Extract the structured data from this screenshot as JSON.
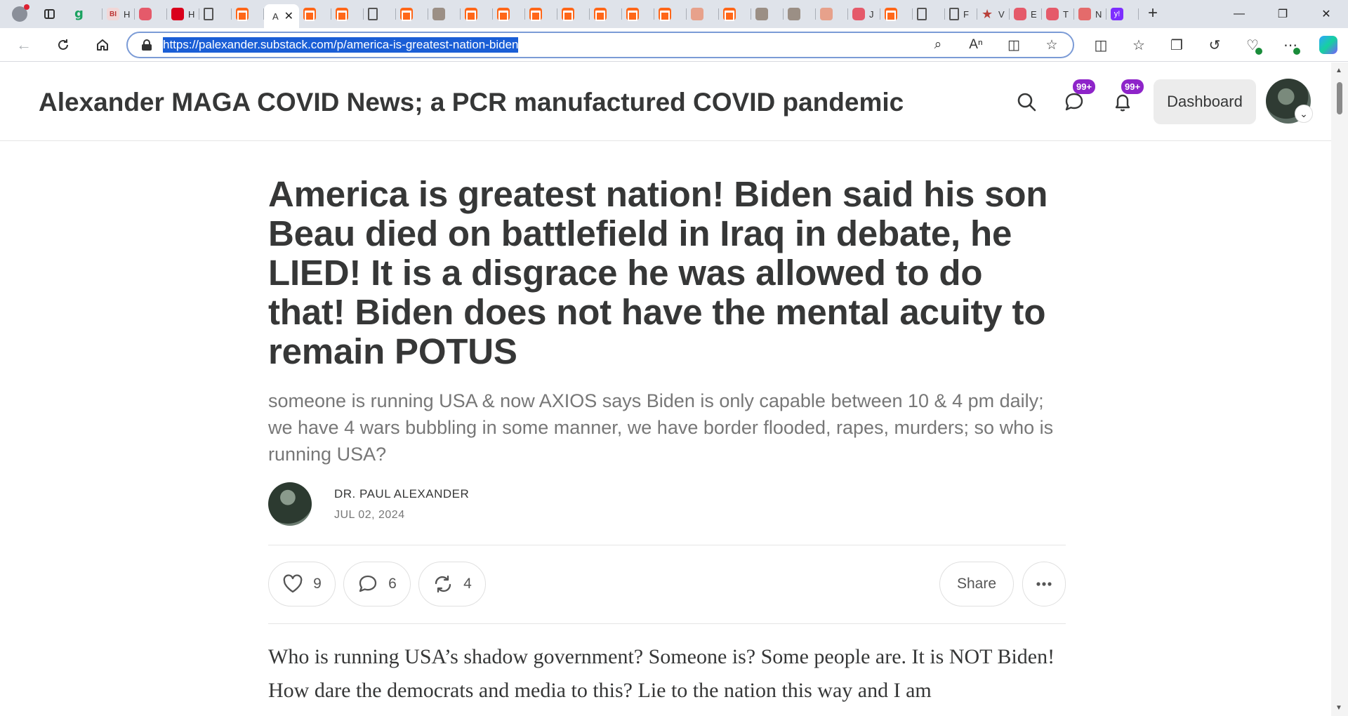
{
  "browser": {
    "tabs": [
      {
        "type": "g",
        "text": "g",
        "suffix": ""
      },
      {
        "type": "bi",
        "text": "BI",
        "suffix": "H"
      },
      {
        "type": "yt",
        "text": "",
        "suffix": ""
      },
      {
        "type": "red",
        "text": "",
        "suffix": "H"
      },
      {
        "type": "doc",
        "text": "",
        "suffix": ""
      },
      {
        "type": "ss",
        "text": "",
        "suffix": ""
      },
      {
        "type": "active",
        "text": "",
        "suffix": ""
      },
      {
        "type": "ss",
        "text": "",
        "suffix": ""
      },
      {
        "type": "ss",
        "text": "",
        "suffix": ""
      },
      {
        "type": "doc",
        "text": "",
        "suffix": ""
      },
      {
        "type": "ss",
        "text": "",
        "suffix": ""
      },
      {
        "type": "photo",
        "text": "",
        "suffix": ""
      },
      {
        "type": "ss",
        "text": "",
        "suffix": ""
      },
      {
        "type": "ss",
        "text": "",
        "suffix": ""
      },
      {
        "type": "ss",
        "text": "",
        "suffix": ""
      },
      {
        "type": "ss",
        "text": "",
        "suffix": ""
      },
      {
        "type": "ss",
        "text": "",
        "suffix": ""
      },
      {
        "type": "ss",
        "text": "",
        "suffix": ""
      },
      {
        "type": "ss",
        "text": "",
        "suffix": ""
      },
      {
        "type": "pink",
        "text": "",
        "suffix": ""
      },
      {
        "type": "ss",
        "text": "",
        "suffix": ""
      },
      {
        "type": "photo",
        "text": "",
        "suffix": ""
      },
      {
        "type": "photo",
        "text": "",
        "suffix": ""
      },
      {
        "type": "pink",
        "text": "",
        "suffix": ""
      },
      {
        "type": "yt",
        "text": "",
        "suffix": "J"
      },
      {
        "type": "ss",
        "text": "",
        "suffix": ""
      },
      {
        "type": "doc",
        "text": "",
        "suffix": ""
      },
      {
        "type": "doc",
        "text": "",
        "suffix": "F"
      },
      {
        "type": "star",
        "text": "★",
        "suffix": "V"
      },
      {
        "type": "yt",
        "text": "",
        "suffix": "E"
      },
      {
        "type": "yt",
        "text": "",
        "suffix": "T"
      },
      {
        "type": "rr",
        "text": "",
        "suffix": "N"
      },
      {
        "type": "yh",
        "text": "y!",
        "suffix": ""
      }
    ],
    "active_tab_label": "A",
    "url": "https://palexander.substack.com/p/america-is-greatest-nation-biden"
  },
  "header": {
    "site_title": "Alexander MAGA COVID News; a PCR manufactured COVID pandemic",
    "chat_badge": "99+",
    "notif_badge": "99+",
    "dashboard_label": "Dashboard"
  },
  "post": {
    "title": "America is greatest nation! Biden said his son Beau died on battlefield in Iraq in debate, he LIED! It is a disgrace he was allowed to do that! Biden does not have the mental acuity to remain POTUS",
    "subtitle": "someone is running USA & now AXIOS says Biden is only capable between 10 & 4 pm daily; we have 4 wars bubbling in some manner, we have border flooded, rapes, murders; so who is running USA?",
    "author": "DR. PAUL ALEXANDER",
    "date": "JUL 02, 2024",
    "likes": "9",
    "comments": "6",
    "restacks": "4",
    "share_label": "Share",
    "body": "Who is running USA’s shadow government? Someone is? Some people are. It is NOT Biden! How dare the democrats and media to this? Lie to the nation this way and I am"
  },
  "colors": {
    "badge": "#8e24c9",
    "url_highlight": "#1a5ed6",
    "substack_orange": "#ff6719"
  }
}
